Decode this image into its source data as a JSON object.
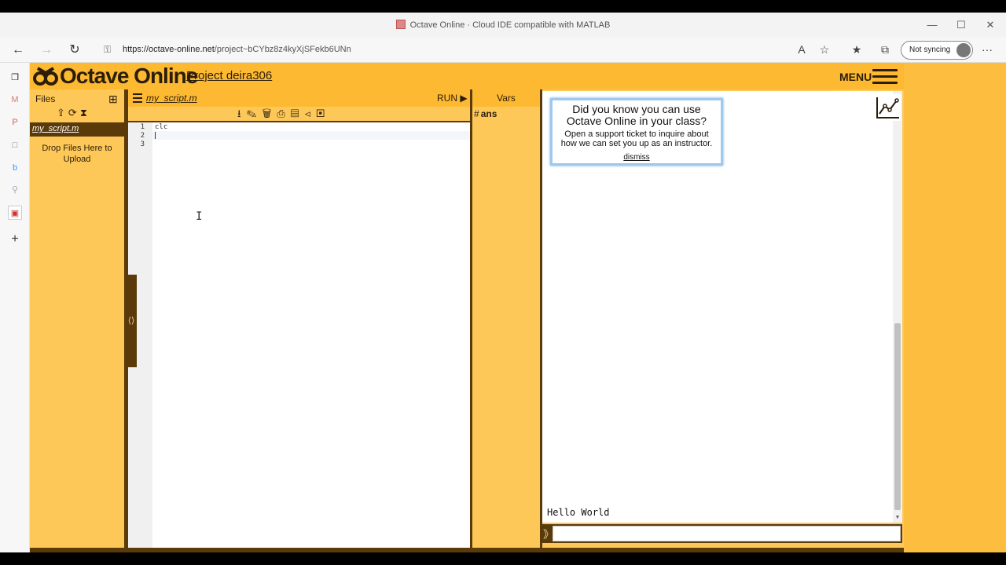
{
  "window": {
    "title": "Octave Online · Cloud IDE compatible with MATLAB",
    "minimize": "—",
    "maximize": "☐",
    "close": "✕"
  },
  "browser": {
    "url_host": "https://octave-online.net",
    "url_path": "/project~bCYbz8z4kyXjSFekb6UNn",
    "sync_label": "Not syncing",
    "more": "···"
  },
  "header": {
    "logo_text": "Octave Online",
    "project_link": "Project deira306",
    "menu_label": "MENU"
  },
  "files": {
    "title": "Files",
    "add_icon": "+",
    "tools": "⇪⟳⧗",
    "items": [
      {
        "label": "my_script.m"
      }
    ],
    "dropzone": "Drop Files Here to Upload"
  },
  "editor": {
    "filename": "my_script.m",
    "run_label": "RUN ▶",
    "tools": "⭳✎🗑⎙▤⟨⟩▣",
    "line_numbers": [
      "1",
      "2",
      "3"
    ],
    "lines": [
      "clc",
      "",
      ""
    ],
    "splitter": "⟨⟩"
  },
  "vars": {
    "title": "Vars",
    "items": [
      {
        "type": "#",
        "name": "ans"
      }
    ]
  },
  "notice": {
    "title": "Did you know you can use Octave Online in your class?",
    "body": "Open a support ticket to inquire about how we can set you up as an instructor.",
    "dismiss": "dismiss"
  },
  "console": {
    "output": "Hello World",
    "prompt": "》",
    "input_value": ""
  },
  "colors": {
    "app_bg": "#fec859",
    "header_bg": "#fdb932",
    "dark_brown": "#5a3a08",
    "notice_border": "#9fc8ef"
  }
}
